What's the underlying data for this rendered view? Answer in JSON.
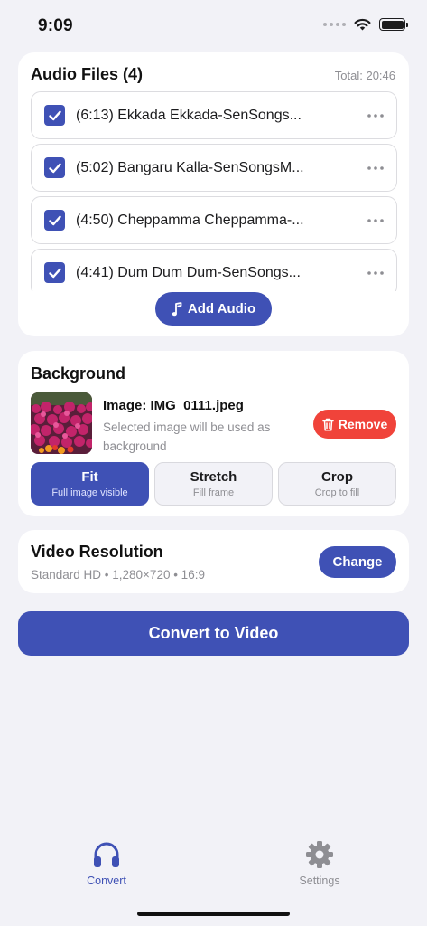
{
  "status_bar": {
    "time": "9:09"
  },
  "audio_card": {
    "title": "Audio Files (4)",
    "total": "Total: 20:46",
    "tracks": [
      {
        "label": "(6:13) Ekkada Ekkada-SenSongs...",
        "checked": true
      },
      {
        "label": "(5:02) Bangaru Kalla-SenSongsM...",
        "checked": true
      },
      {
        "label": "(4:50) Cheppamma Cheppamma-...",
        "checked": true
      },
      {
        "label": "(4:41) Dum Dum Dum-SenSongs...",
        "checked": true
      }
    ],
    "add_button": "Add Audio"
  },
  "background_card": {
    "title": "Background",
    "image_name": "Image: IMG_0111.jpeg",
    "hint": "Selected image will be used as background",
    "remove_button": "Remove",
    "modes": [
      {
        "label": "Fit",
        "sub": "Full image visible",
        "selected": true
      },
      {
        "label": "Stretch",
        "sub": "Fill frame",
        "selected": false
      },
      {
        "label": "Crop",
        "sub": "Crop to fill",
        "selected": false
      }
    ]
  },
  "resolution_card": {
    "title": "Video Resolution",
    "subtitle": "Standard HD • 1,280×720 • 16:9",
    "change_button": "Change"
  },
  "convert_button": "Convert to Video",
  "tab_bar": {
    "tabs": [
      {
        "label": "Convert",
        "icon": "headphones-icon",
        "active": true
      },
      {
        "label": "Settings",
        "icon": "gear-icon",
        "active": false
      }
    ]
  },
  "colors": {
    "accent": "#3f51b5",
    "danger": "#f0433a",
    "background": "#f2f2f7",
    "secondary_text": "#8e8e93"
  }
}
